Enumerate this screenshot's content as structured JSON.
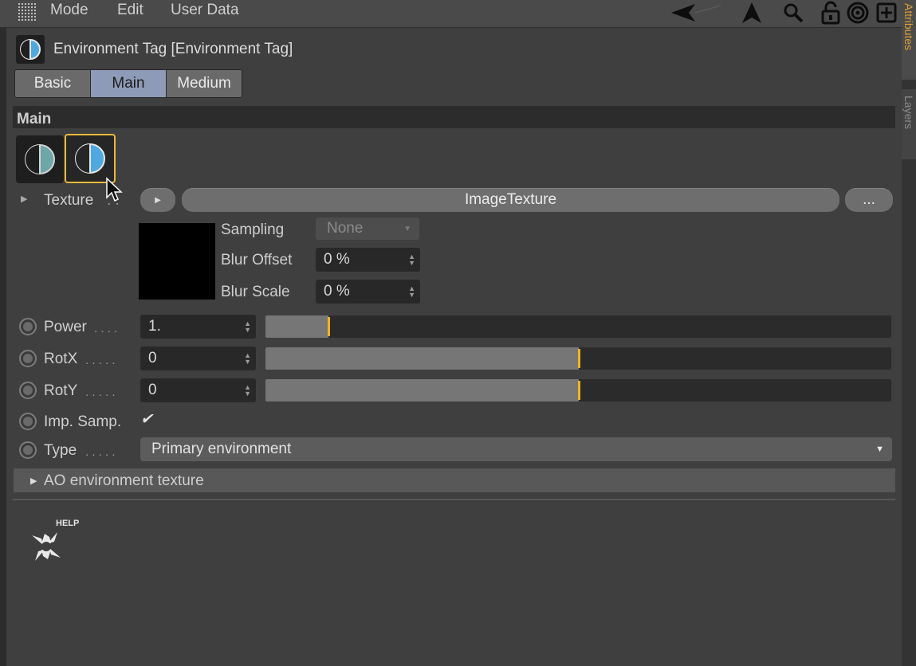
{
  "menu": {
    "items": [
      "Mode",
      "Edit",
      "User Data"
    ]
  },
  "side_tabs": {
    "attributes": "Attributes",
    "layers": "Layers"
  },
  "title": "Environment Tag [Environment Tag]",
  "tabs": [
    {
      "label": "Basic",
      "active": false
    },
    {
      "label": "Main",
      "active": true
    },
    {
      "label": "Medium",
      "active": false
    }
  ],
  "section": {
    "title": "Main"
  },
  "texture": {
    "label": "Texture",
    "dots": ". .",
    "value": "ImageTexture",
    "more_label": "...",
    "sampling_label": "Sampling",
    "sampling_value": "None",
    "blur_offset_label": "Blur Offset",
    "blur_offset_value": "0 %",
    "blur_scale_label": "Blur Scale",
    "blur_scale_value": "0 %"
  },
  "params": {
    "power": {
      "label": "Power",
      "dots": ". . . .",
      "value": "1.",
      "slider_fraction": 0.1
    },
    "rotx": {
      "label": "RotX",
      "dots": ". . . . .",
      "value": "0",
      "slider_fraction": 0.5
    },
    "roty": {
      "label": "RotY",
      "dots": ". . . . .",
      "value": "0",
      "slider_fraction": 0.5
    },
    "imp_samp": {
      "label": "Imp. Samp.",
      "checked": true,
      "check_glyph": "✔"
    },
    "type": {
      "label": "Type",
      "dots": ". . . . .",
      "value": "Primary environment"
    }
  },
  "ao": {
    "label": "AO environment texture"
  },
  "help": {
    "label": "HELP"
  },
  "colors": {
    "accent": "#f0b323",
    "active_tab": "#8e9bb8",
    "icon_blue": "#4fa9e0",
    "icon_teal": "#6fa6a8"
  }
}
